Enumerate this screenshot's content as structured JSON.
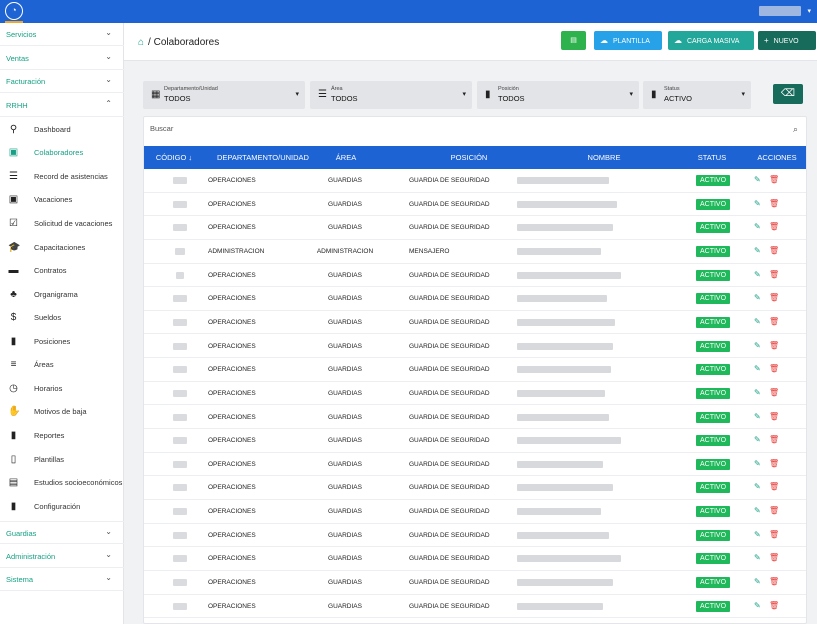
{
  "colors": {
    "topbar": "#1e63d3",
    "accent": "#16a085",
    "table_header": "#1e63d3",
    "active_badge": "#1fb85a",
    "delete": "#e53935"
  },
  "topbar": {
    "logo_icon": "app-logo-icon",
    "user_caret": "▾"
  },
  "sidebar": {
    "sections": [
      {
        "label": "Servicios",
        "chevron": "⌄"
      },
      {
        "label": "Ventas",
        "chevron": "⌄"
      },
      {
        "label": "Facturación",
        "chevron": "⌄"
      },
      {
        "label": "RRHH",
        "chevron": "⌃"
      }
    ],
    "items": [
      {
        "label": "Dashboard",
        "icon": "dashboard-icon",
        "glyph": "⚲"
      },
      {
        "label": "Colaboradores",
        "icon": "badge-icon",
        "glyph": "▣"
      },
      {
        "label": "Record de asistencias",
        "icon": "list-icon",
        "glyph": "☰"
      },
      {
        "label": "Vacaciones",
        "icon": "badge-icon",
        "glyph": "▣"
      },
      {
        "label": "Solicitud de vacaciones",
        "icon": "checkbox-icon",
        "glyph": "☑"
      },
      {
        "label": "Capacitaciones",
        "icon": "graduation-cap-icon",
        "glyph": "🎓"
      },
      {
        "label": "Contratos",
        "icon": "archive-icon",
        "glyph": "▬"
      },
      {
        "label": "Organigrama",
        "icon": "org-chart-icon",
        "glyph": "♣"
      },
      {
        "label": "Sueldos",
        "icon": "dollar-icon",
        "glyph": "$"
      },
      {
        "label": "Posiciones",
        "icon": "clipboard-icon",
        "glyph": "▮"
      },
      {
        "label": "Áreas",
        "icon": "list-icon",
        "glyph": "≡"
      },
      {
        "label": "Horarios",
        "icon": "clock-file-icon",
        "glyph": "◷"
      },
      {
        "label": "Motivos de baja",
        "icon": "thumbs-down-icon",
        "glyph": "✋"
      },
      {
        "label": "Reportes",
        "icon": "clipboard-icon",
        "glyph": "▮"
      },
      {
        "label": "Plantillas",
        "icon": "clipboard-outline-icon",
        "glyph": "▯"
      },
      {
        "label": "Estudios socioeconómicos",
        "icon": "document-icon",
        "glyph": "▤"
      },
      {
        "label": "Configuración",
        "icon": "clipboard-icon",
        "glyph": "▮"
      }
    ],
    "bottom_sections": [
      {
        "label": "Guardias",
        "chevron": "⌄"
      },
      {
        "label": "Administración",
        "chevron": "⌄"
      },
      {
        "label": "Sistema",
        "chevron": "⌄"
      }
    ]
  },
  "header": {
    "home_glyph": "⌂",
    "breadcrumb": "/ Colaboradores",
    "buttons": {
      "xls_glyph": "▤",
      "plantilla": "PLANTILLA",
      "carga_masiva": "CARGA MASIVA",
      "nuevo": "NUEVO",
      "upload_glyph": "☁",
      "plus_glyph": "+"
    }
  },
  "filters": [
    {
      "label": "Departamento/Unidad",
      "value": "TODOS",
      "glyph": "▦"
    },
    {
      "label": "Área",
      "value": "TODOS",
      "glyph": "☰"
    },
    {
      "label": "Posición",
      "value": "TODOS",
      "glyph": "▮"
    },
    {
      "label": "Status",
      "value": "ACTIVO",
      "glyph": "▮"
    }
  ],
  "filter_caret": "▾",
  "eraser_glyph": "⌫",
  "search": {
    "placeholder": "Buscar",
    "glyph": "⌕"
  },
  "table": {
    "columns": [
      "CÓDIGO ↓",
      "DEPARTAMENTO/UNIDAD",
      "ÁREA",
      "POSICIÓN",
      "NOMBRE",
      "STATUS",
      "ACCIONES"
    ],
    "edit_glyph": "✎",
    "delete_glyph": "🗑",
    "rows": [
      {
        "dep": "OPERACIONES",
        "area": "GUARDIAS",
        "pos": "GUARDIA DE SEGURIDAD",
        "status": "ACTIVO"
      },
      {
        "dep": "OPERACIONES",
        "area": "GUARDIAS",
        "pos": "GUARDIA DE SEGURIDAD",
        "status": "ACTIVO"
      },
      {
        "dep": "OPERACIONES",
        "area": "GUARDIAS",
        "pos": "GUARDIA DE SEGURIDAD",
        "status": "ACTIVO"
      },
      {
        "dep": "ADMINISTRACION",
        "area": "ADMINISTRACION",
        "pos": "MENSAJERO",
        "status": "ACTIVO"
      },
      {
        "dep": "OPERACIONES",
        "area": "GUARDIAS",
        "pos": "GUARDIA DE SEGURIDAD",
        "status": "ACTIVO"
      },
      {
        "dep": "OPERACIONES",
        "area": "GUARDIAS",
        "pos": "GUARDIA DE SEGURIDAD",
        "status": "ACTIVO"
      },
      {
        "dep": "OPERACIONES",
        "area": "GUARDIAS",
        "pos": "GUARDIA DE SEGURIDAD",
        "status": "ACTIVO"
      },
      {
        "dep": "OPERACIONES",
        "area": "GUARDIAS",
        "pos": "GUARDIA DE SEGURIDAD",
        "status": "ACTIVO"
      },
      {
        "dep": "OPERACIONES",
        "area": "GUARDIAS",
        "pos": "GUARDIA DE SEGURIDAD",
        "status": "ACTIVO"
      },
      {
        "dep": "OPERACIONES",
        "area": "GUARDIAS",
        "pos": "GUARDIA DE SEGURIDAD",
        "status": "ACTIVO"
      },
      {
        "dep": "OPERACIONES",
        "area": "GUARDIAS",
        "pos": "GUARDIA DE SEGURIDAD",
        "status": "ACTIVO"
      },
      {
        "dep": "OPERACIONES",
        "area": "GUARDIAS",
        "pos": "GUARDIA DE SEGURIDAD",
        "status": "ACTIVO"
      },
      {
        "dep": "OPERACIONES",
        "area": "GUARDIAS",
        "pos": "GUARDIA DE SEGURIDAD",
        "status": "ACTIVO"
      },
      {
        "dep": "OPERACIONES",
        "area": "GUARDIAS",
        "pos": "GUARDIA DE SEGURIDAD",
        "status": "ACTIVO"
      },
      {
        "dep": "OPERACIONES",
        "area": "GUARDIAS",
        "pos": "GUARDIA DE SEGURIDAD",
        "status": "ACTIVO"
      },
      {
        "dep": "OPERACIONES",
        "area": "GUARDIAS",
        "pos": "GUARDIA DE SEGURIDAD",
        "status": "ACTIVO"
      },
      {
        "dep": "OPERACIONES",
        "area": "GUARDIAS",
        "pos": "GUARDIA DE SEGURIDAD",
        "status": "ACTIVO"
      },
      {
        "dep": "OPERACIONES",
        "area": "GUARDIAS",
        "pos": "GUARDIA DE SEGURIDAD",
        "status": "ACTIVO"
      },
      {
        "dep": "OPERACIONES",
        "area": "GUARDIAS",
        "pos": "GUARDIA DE SEGURIDAD",
        "status": "ACTIVO"
      },
      {
        "dep": "OPERACIONES",
        "area": "GUARDIAS",
        "pos": "GUARDIA DE SEGURIDAD",
        "status": "ACTIVO"
      }
    ]
  }
}
